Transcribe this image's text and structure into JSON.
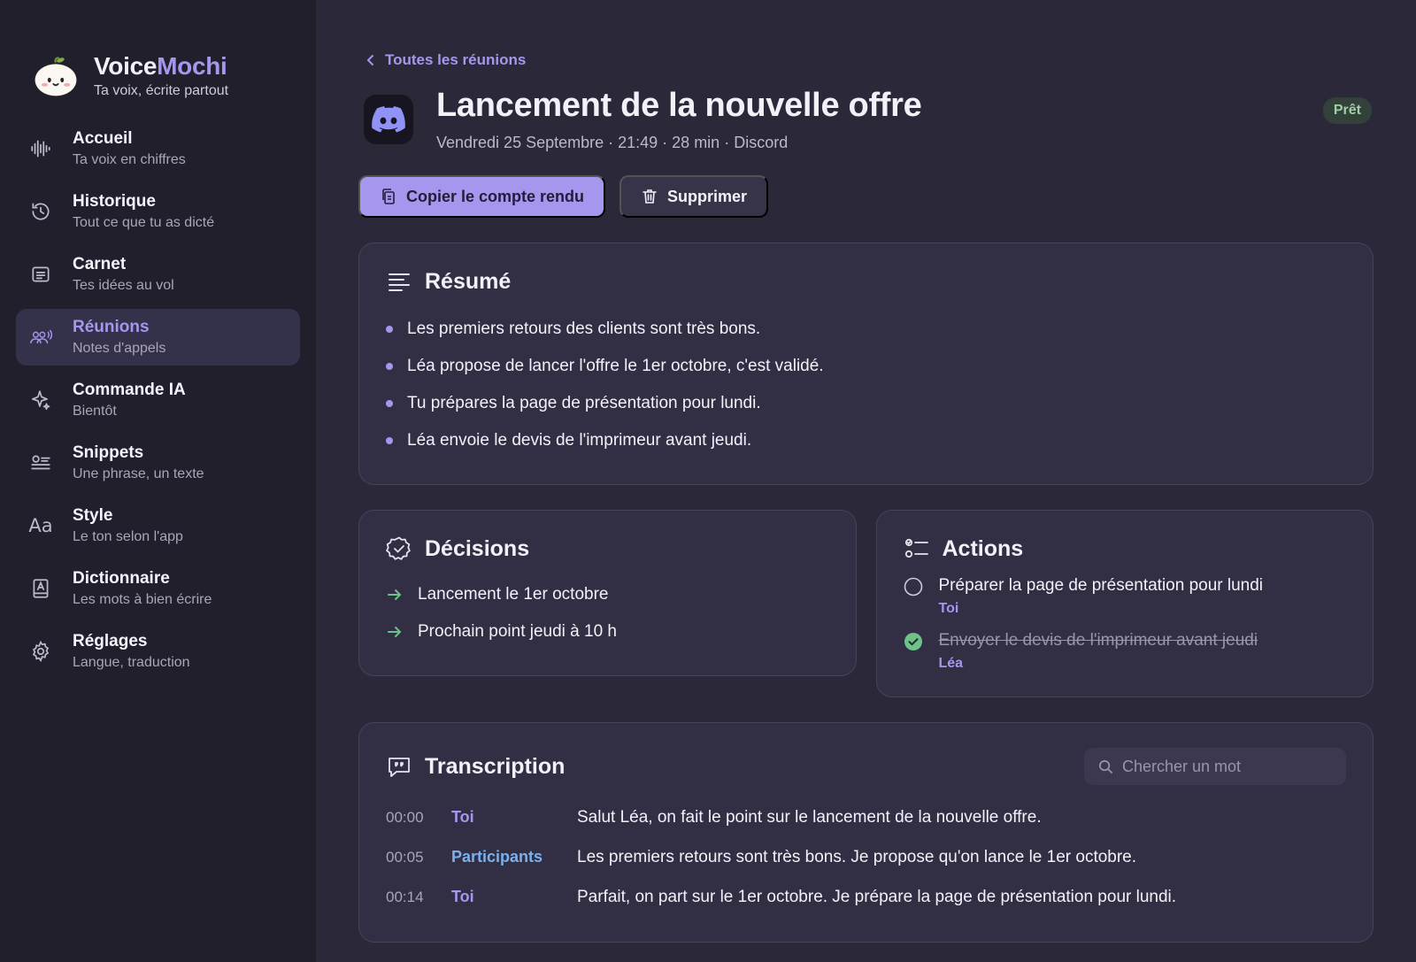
{
  "brand": {
    "name_main": "Voice",
    "name_accent": "Mochi",
    "tagline": "Ta voix, écrite partout"
  },
  "sidebar": {
    "items": [
      {
        "title": "Accueil",
        "subtitle": "Ta voix en chiffres",
        "icon": "waveform-icon"
      },
      {
        "title": "Historique",
        "subtitle": "Tout ce que tu as dicté",
        "icon": "history-icon"
      },
      {
        "title": "Carnet",
        "subtitle": "Tes idées au vol",
        "icon": "notebook-icon"
      },
      {
        "title": "Réunions",
        "subtitle": "Notes d'appels",
        "icon": "meeting-icon",
        "active": true
      },
      {
        "title": "Commande IA",
        "subtitle": "Bientôt",
        "icon": "sparkle-icon"
      },
      {
        "title": "Snippets",
        "subtitle": "Une phrase, un texte",
        "icon": "snippets-icon"
      },
      {
        "title": "Style",
        "subtitle": "Le ton selon l'app",
        "icon": "text-style-icon",
        "glyph": "Aa"
      },
      {
        "title": "Dictionnaire",
        "subtitle": "Les mots à bien écrire",
        "icon": "dictionary-icon"
      },
      {
        "title": "Réglages",
        "subtitle": "Langue, traduction",
        "icon": "gear-icon"
      }
    ]
  },
  "main": {
    "back_label": "Toutes les réunions",
    "title": "Lancement de la nouvelle offre",
    "meta": "Vendredi 25 Septembre · 21:49 · 28 min · Discord",
    "status": "Prêt",
    "copy_button": "Copier le compte rendu",
    "delete_button": "Supprimer"
  },
  "summary": {
    "title": "Résumé",
    "bullets": [
      "Les premiers retours des clients sont très bons.",
      "Léa propose de lancer l'offre le 1er octobre, c'est validé.",
      "Tu prépares la page de présentation pour lundi.",
      "Léa envoie le devis de l'imprimeur avant jeudi."
    ]
  },
  "decisions": {
    "title": "Décisions",
    "items": [
      "Lancement le 1er octobre",
      "Prochain point jeudi à 10 h"
    ]
  },
  "actions": {
    "title": "Actions",
    "items": [
      {
        "text": "Préparer la page de présentation pour lundi",
        "owner": "Toi",
        "done": false
      },
      {
        "text": "Envoyer le devis de l'imprimeur avant jeudi",
        "owner": "Léa",
        "done": true
      }
    ]
  },
  "transcript": {
    "title": "Transcription",
    "search_placeholder": "Chercher un mot",
    "rows": [
      {
        "time": "00:00",
        "speaker": "Toi",
        "text": "Salut Léa, on fait le point sur le lancement de la nouvelle offre."
      },
      {
        "time": "00:05",
        "speaker": "Participants",
        "text": "Les premiers retours sont très bons. Je propose qu'on lance le 1er octobre."
      },
      {
        "time": "00:14",
        "speaker": "Toi",
        "text": "Parfait, on part sur le 1er octobre. Je prépare la page de présentation pour lundi."
      }
    ]
  },
  "colors": {
    "accent": "#a796ee",
    "success": "#6fc18a",
    "background": "#2b2839",
    "sidebar": "#211f2c"
  }
}
